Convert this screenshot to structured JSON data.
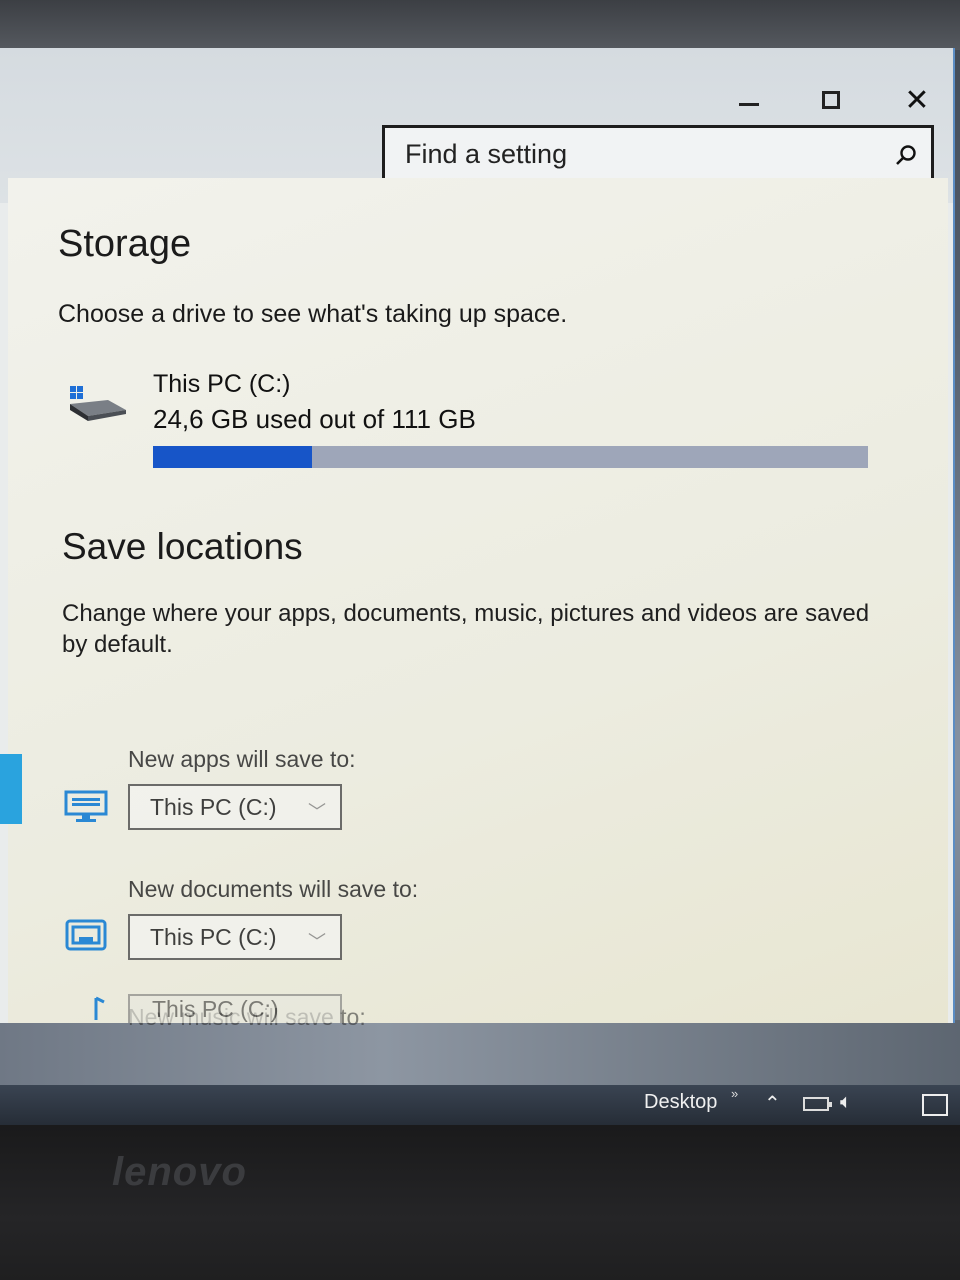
{
  "window": {
    "minimize_label": "",
    "maximize_label": "",
    "close_label": "✕"
  },
  "search": {
    "placeholder": "Find a setting"
  },
  "storage": {
    "title": "Storage",
    "subtitle": "Choose a drive to see what's taking up space.",
    "drive": {
      "name": "This PC (C:)",
      "usage_text": "24,6 GB used out of 111 GB",
      "used_fraction": 0.222,
      "bar_color": "#1755c8",
      "track_color": "#9ea6b9"
    }
  },
  "save_locations": {
    "title": "Save locations",
    "description": "Change where your apps, documents, music, pictures and videos are saved by default.",
    "items": [
      {
        "label": "New apps will save to:",
        "value": "This PC (C:)",
        "icon": "monitor-icon"
      },
      {
        "label": "New documents will save to:",
        "value": "This PC (C:)",
        "icon": "documents-icon"
      },
      {
        "label": "New music will save to:",
        "value": "This PC (C:)",
        "icon": "music-note-icon"
      }
    ]
  },
  "taskbar": {
    "desktop_label": "Desktop",
    "more_label": "»"
  },
  "hardware": {
    "brand": "lenovo"
  },
  "colors": {
    "accent": "#2aa3de",
    "progress": "#1755c8"
  }
}
